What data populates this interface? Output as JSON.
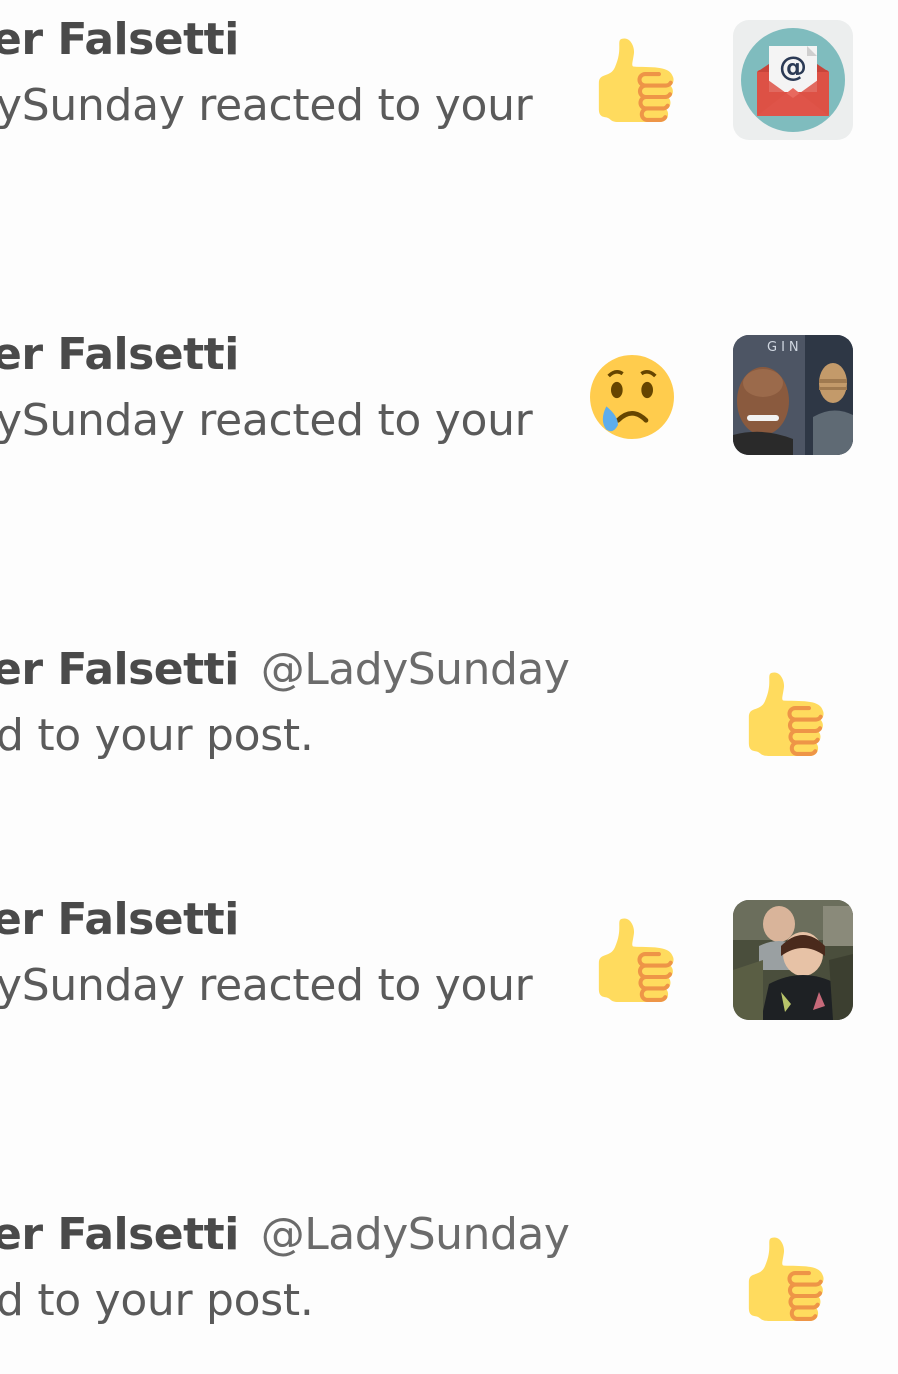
{
  "notifications": [
    {
      "name": "er Falsetti",
      "handle": "",
      "body": "ySunday reacted to your",
      "reaction": "thumbs-up",
      "thumbnail": "email-icon"
    },
    {
      "name": "er Falsetti",
      "handle": "",
      "body": "ySunday reacted to your",
      "reaction": "crying-face",
      "thumbnail": "photo-star-trek-actor"
    },
    {
      "name": "er Falsetti",
      "handle": "@LadySunday",
      "body": "d to your post.",
      "reaction": "thumbs-up",
      "thumbnail": ""
    },
    {
      "name": "er Falsetti",
      "handle": "",
      "body": "ySunday reacted to your",
      "reaction": "thumbs-up",
      "thumbnail": "photo-group"
    },
    {
      "name": "er Falsetti",
      "handle": "@LadySunday",
      "body": "d to your post.",
      "reaction": "thumbs-up",
      "thumbnail": ""
    }
  ],
  "colors": {
    "background": "#fdfdfd",
    "name_text": "#4a4a4a",
    "body_text": "#5a5a5a",
    "emoji_yellow": "#FFCC4D",
    "emoji_orange": "#EE9547",
    "envelope_red": "#DD5145",
    "envelope_bg": "#7FBCBE"
  }
}
